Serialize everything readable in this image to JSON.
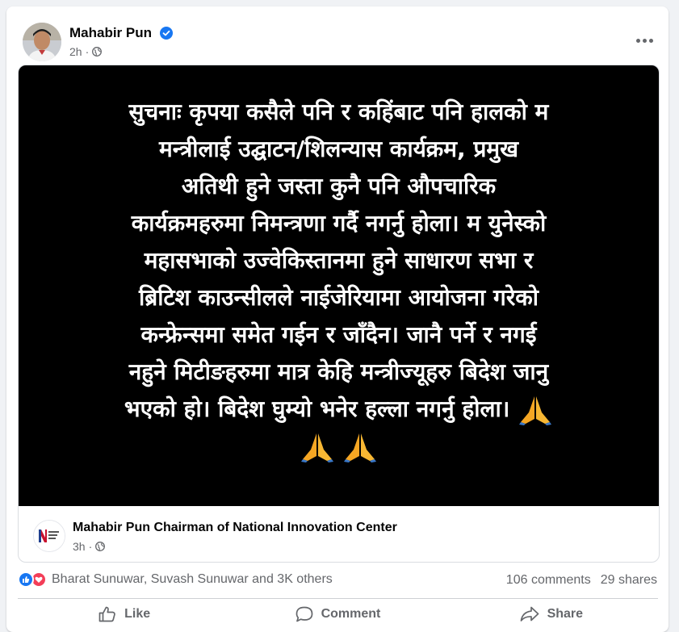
{
  "post": {
    "author": "Mahabir Pun",
    "time": "2h",
    "notice_lines": [
      "सुचनाः कृपया कसैले पनि र कहिंबाट पनि हालको म",
      "मन्त्रीलाई उद्घाटन/शिलन्यास कार्यक्रम, प्रमुख",
      "अतिथी हुने जस्ता कुनै पनि औपचारिक",
      "कार्यक्रमहरुमा निमन्त्रणा गर्दै नगर्नु होला। म युनेस्को",
      "महासभाको उज्वेकिस्तानमा हुने साधारण सभा र",
      "ब्रिटिश काउन्सीलले नाईजेरियामा आयोजना गरेको",
      "कन्फ्रेन्समा समेत गईन र जाँदैन। जानै पर्ने र नगई",
      "नहुने मिटीङहरुमा मात्र केहि मन्त्रीज्यूहरु बिदेश जानु",
      "भएको हो। बिदेश घुम्यो भनेर हल्ला नगर्नु होला।"
    ],
    "shared_title": "Mahabir Pun Chairman of National Innovation Center",
    "shared_time": "3h",
    "reactions_text": "Bharat Sunuwar, Suvash Sunuwar and 3K others",
    "comments": "106 comments",
    "shares": "29 shares",
    "actions": {
      "like": "Like",
      "comment": "Comment",
      "share": "Share"
    }
  },
  "icons": {
    "verified": "verified-badge-icon",
    "privacy": "globe-icon",
    "more": "more-dots-icon",
    "pray": "folded-hands-emoji",
    "like": "thumbs-up-icon",
    "comment": "speech-bubble-icon",
    "share": "share-arrow-icon"
  },
  "colors": {
    "brand_blue": "#1877f2",
    "love_red": "#f33e58",
    "muted_text": "#65676b",
    "image_bg": "#000000"
  }
}
